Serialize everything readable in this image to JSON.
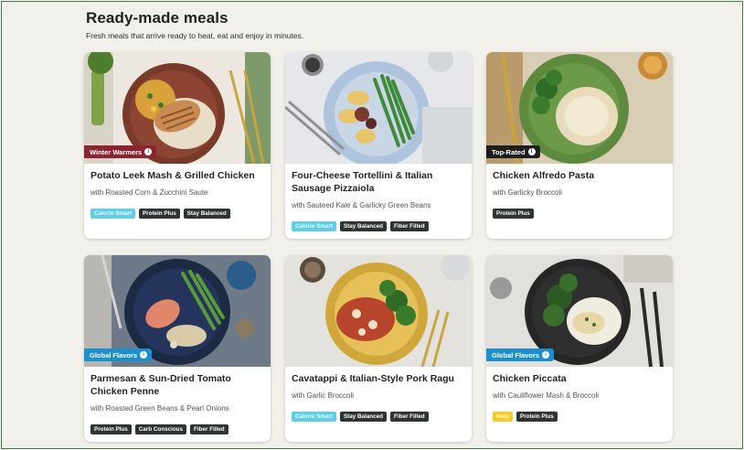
{
  "header": {
    "title": "Ready-made meals",
    "subtitle": "Fresh meals that arrive ready to heat, eat and enjoy in minutes."
  },
  "colors": {
    "winter_warmers": "#8a2430",
    "top_rated": "#1e1e1e",
    "global_flavors": "#1c8fd0",
    "calorie_smart": "#60cce6",
    "keto": "#f4cc2a",
    "dark_tag": "#2d3433"
  },
  "meals": [
    {
      "title": "Potato Leek Mash & Grilled Chicken",
      "description": "with Roasted Corn & Zucchini Saute",
      "badge": "Winter Warmers",
      "tags": [
        "Calorie Smart",
        "Protein Plus",
        "Stay Balanced"
      ]
    },
    {
      "title": "Four-Cheese Tortellini & Italian Sausage Pizzaiola",
      "description": "with Sauteed Kale & Garlicky Green Beans",
      "badge": "",
      "tags": [
        "Calorie Smart",
        "Stay Balanced",
        "Fiber Filled"
      ]
    },
    {
      "title": "Chicken Alfredo Pasta",
      "description": "with Garlicky Broccoli",
      "badge": "Top-Rated",
      "tags": [
        "Protein Plus"
      ]
    },
    {
      "title": "Parmesan & Sun-Dried Tomato Chicken Penne",
      "description": "with Roasted Green Beans & Pearl Onions",
      "badge": "Global Flavors",
      "tags": [
        "Protein Plus",
        "Carb Conscious",
        "Fiber Filled"
      ]
    },
    {
      "title": "Cavatappi & Italian-Style Pork Ragu",
      "description": "with Garlic Broccoli",
      "badge": "",
      "tags": [
        "Calorie Smart",
        "Stay Balanced",
        "Fiber Filled"
      ]
    },
    {
      "title": "Chicken Piccata",
      "description": "with Cauliflower Mash & Broccoli",
      "badge": "Global Flavors",
      "tags": [
        "Keto",
        "Protein Plus"
      ]
    }
  ]
}
